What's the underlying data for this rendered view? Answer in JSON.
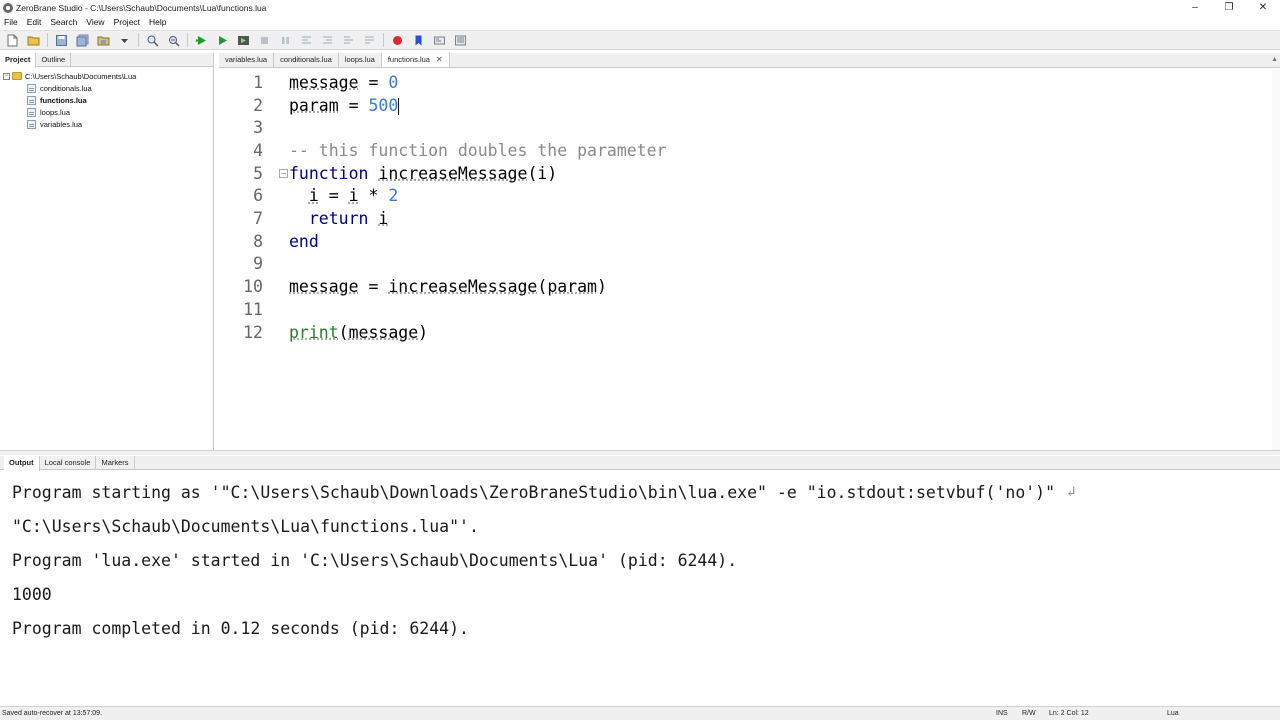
{
  "window": {
    "title": "ZeroBrane Studio - C:\\Users\\Schaub\\Documents\\Lua\\functions.lua",
    "minimize": "–",
    "maximize": "❐",
    "close": "✕"
  },
  "menu": [
    "File",
    "Edit",
    "Search",
    "View",
    "Project",
    "Help"
  ],
  "toolbar": {
    "icons": [
      "new-file-icon",
      "open-file-icon",
      "save-icon",
      "save-all-icon",
      "project-dir-icon",
      "find-icon",
      "replace-icon",
      "run-icon",
      "start-debug-icon",
      "compile-icon",
      "stop-icon",
      "break-icon",
      "step-into-icon",
      "step-over-icon",
      "step-out-icon",
      "breakpoint-icon",
      "bookmark-icon",
      "watch-icon",
      "stack-icon"
    ]
  },
  "left_panel": {
    "tabs": [
      "Project",
      "Outline"
    ],
    "active_tab": "Project",
    "root": "C:\\Users\\Schaub\\Documents\\Lua",
    "files": [
      "conditionals.lua",
      "functions.lua",
      "loops.lua",
      "variables.lua"
    ],
    "current_file": "functions.lua"
  },
  "editor_tabs": [
    {
      "label": "variables.lua"
    },
    {
      "label": "conditionals.lua"
    },
    {
      "label": "loops.lua"
    },
    {
      "label": "functions.lua",
      "active": true,
      "close": "✕"
    }
  ],
  "editor": {
    "lines": [
      {
        "n": "1"
      },
      {
        "n": "2"
      },
      {
        "n": "3"
      },
      {
        "n": "4"
      },
      {
        "n": "5"
      },
      {
        "n": "6"
      },
      {
        "n": "7"
      },
      {
        "n": "8"
      },
      {
        "n": "9"
      },
      {
        "n": "10"
      },
      {
        "n": "11"
      },
      {
        "n": "12"
      }
    ],
    "code": {
      "l1_a": "message",
      "l1_b": " = ",
      "l1_c": "0",
      "l2_a": "param",
      "l2_b": " = ",
      "l2_c": "500",
      "l4": "-- this function doubles the parameter",
      "l5_kw": "function",
      "l5_sp": " ",
      "l5_fn": "increaseMessage",
      "l5_rest": "(i)",
      "l6_a": "  ",
      "l6_b": "i",
      "l6_c": " = ",
      "l6_d": "i",
      "l6_e": " * ",
      "l6_f": "2",
      "l7_a": "  ",
      "l7_kw": "return",
      "l7_b": " ",
      "l7_c": "i",
      "l8_kw": "end",
      "l10_a": "message",
      "l10_b": " = ",
      "l10_c": "increaseMessage",
      "l10_d": "(",
      "l10_e": "param",
      "l10_f": ")",
      "l12_fn": "print",
      "l12_a": "(",
      "l12_b": "message",
      "l12_c": ")"
    },
    "fold_marker": "⊟"
  },
  "bottom_panel": {
    "tabs": [
      "Output",
      "Local console",
      "Markers"
    ],
    "active_tab": "Output",
    "output_lines": [
      "Program starting as '\"C:\\Users\\Schaub\\Downloads\\ZeroBraneStudio\\bin\\lua.exe\" -e \"io.stdout:setvbuf('no')\"",
      "\"C:\\Users\\Schaub\\Documents\\Lua\\functions.lua\"'.",
      "Program 'lua.exe' started in 'C:\\Users\\Schaub\\Documents\\Lua' (pid: 6244).",
      "1000",
      "Program completed in 0.12 seconds (pid: 6244)."
    ],
    "wrap_mark": "↲"
  },
  "status": {
    "message": "Saved auto-recover at 13:57:09.",
    "mode": "INS",
    "rw": "R/W",
    "position": "Ln: 2 Col: 12",
    "language": "Lua"
  },
  "colors": {
    "keyword": "#00008b",
    "number": "#3d7ad3",
    "comment": "#8a8a8a",
    "function": "#2d7a2d",
    "run_green": "#1f9d2b",
    "stop_red": "#d92b2b",
    "bookmark_blue": "#2b4fd9"
  }
}
